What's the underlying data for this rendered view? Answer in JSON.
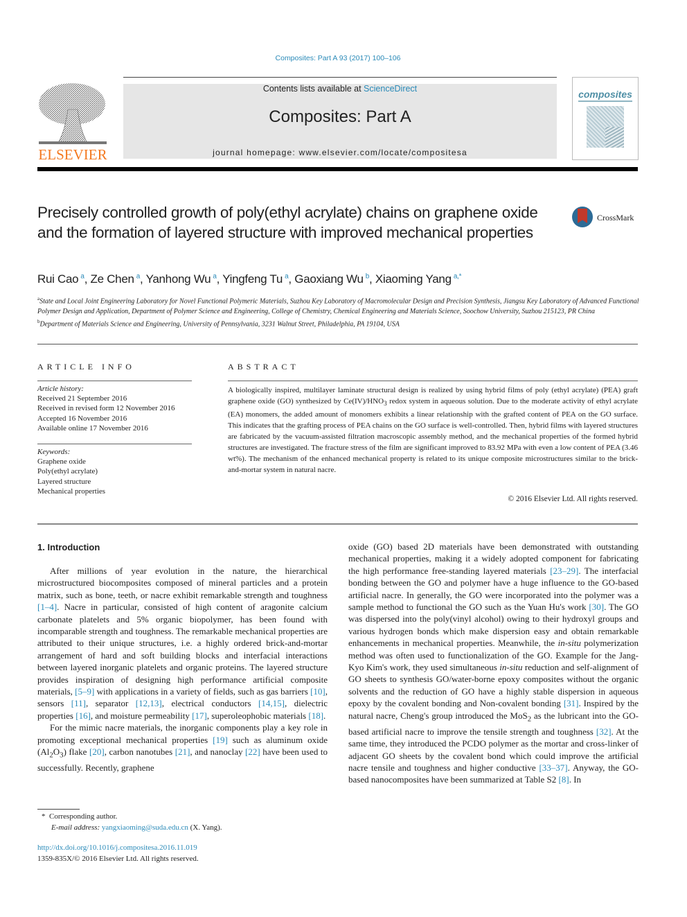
{
  "header": {
    "citation": "Composites: Part A 93 (2017) 100–106",
    "contents_prefix": "Contents lists available at ",
    "contents_link": "ScienceDirect",
    "journal_title": "Composites: Part A",
    "homepage": "journal homepage: www.elsevier.com/locate/compositesa",
    "publisher_logo_text": "ELSEVIER",
    "cover_title": "composites",
    "crossmark_label": "CrossMark",
    "colors": {
      "link": "#2a8ab8",
      "elsevier_orange": "#f47920"
    }
  },
  "article": {
    "title": "Precisely controlled growth of poly(ethyl acrylate) chains on graphene oxide and the formation of layered structure with improved mechanical properties",
    "authors": [
      {
        "name": "Rui Cao",
        "aff": "a"
      },
      {
        "name": "Ze Chen",
        "aff": "a"
      },
      {
        "name": "Yanhong Wu",
        "aff": "a"
      },
      {
        "name": "Yingfeng Tu",
        "aff": "a"
      },
      {
        "name": "Gaoxiang Wu",
        "aff": "b"
      },
      {
        "name": "Xiaoming Yang",
        "aff": "a,*"
      }
    ],
    "affiliations": [
      {
        "label": "a",
        "text": "State and Local Joint Engineering Laboratory for Novel Functional Polymeric Materials, Suzhou Key Laboratory of Macromolecular Design and Precision Synthesis, Jiangsu Key Laboratory of Advanced Functional Polymer Design and Application, Department of Polymer Science and Engineering, College of Chemistry, Chemical Engineering and Materials Science, Soochow University, Suzhou 215123, PR China"
      },
      {
        "label": "b",
        "text": "Department of Materials Science and Engineering, University of Pennsylvania, 3231 Walnut Street, Philadelphia, PA 19104, USA"
      }
    ]
  },
  "article_info": {
    "heading": "ARTICLE INFO",
    "history_label": "Article history:",
    "history": [
      "Received 21 September 2016",
      "Received in revised form 12 November 2016",
      "Accepted 16 November 2016",
      "Available online 17 November 2016"
    ],
    "keywords_label": "Keywords:",
    "keywords": [
      "Graphene oxide",
      "Poly(ethyl acrylate)",
      "Layered structure",
      "Mechanical properties"
    ]
  },
  "abstract": {
    "heading": "ABSTRACT",
    "part1": "A biologically inspired, multilayer laminate structural design is realized by using hybrid films of poly (ethyl acrylate) (PEA) graft graphene oxide (GO) synthesized by Ce(IV)/HNO",
    "sub1": "3",
    "part2": " redox system in aqueous solution. Due to the moderate activity of ethyl acrylate (EA) monomers, the added amount of monomers exhibits a linear relationship with the grafted content of PEA on the GO surface. This indicates that the grafting process of PEA chains on the GO surface is well-controlled. Then, hybrid films with layered structures are fabricated by the vacuum-assisted filtration macroscopic assembly method, and the mechanical properties of the formed hybrid structures are investigated. The fracture stress of the film are significant improved to 83.92 MPa with even a low content of PEA (3.46 wt%). The mechanism of the enhanced mechanical property is related to its unique composite microstructures similar to the brick-and-mortar system in natural nacre.",
    "copyright": "© 2016 Elsevier Ltd. All rights reserved."
  },
  "body": {
    "section_heading": "1. Introduction",
    "left": {
      "p1": [
        {
          "t": "After millions of year evolution in the nature, the hierarchical microstructured biocomposites composed of mineral particles and a protein matrix, such as bone, teeth, or nacre exhibit remarkable strength and toughness "
        },
        {
          "ref": "[1–4]"
        },
        {
          "t": ". Nacre in particular, consisted of high content of aragonite calcium carbonate platelets and 5% organic biopolymer, has been found with incomparable strength and toughness. The remarkable mechanical properties are attributed to their unique structures, i.e. a highly ordered brick-and-mortar arrangement of hard and soft building blocks and interfacial interactions between layered inorganic platelets and organic proteins. The layered structure provides inspiration of designing high performance artificial composite materials, "
        },
        {
          "ref": "[5–9]"
        },
        {
          "t": " with applications in a variety of fields, such as gas barriers "
        },
        {
          "ref": "[10]"
        },
        {
          "t": ", sensors "
        },
        {
          "ref": "[11]"
        },
        {
          "t": ", separator "
        },
        {
          "ref": "[12,13]"
        },
        {
          "t": ", electrical conductors "
        },
        {
          "ref": "[14,15]"
        },
        {
          "t": ", dielectric properties "
        },
        {
          "ref": "[16]"
        },
        {
          "t": ", and moisture permeability "
        },
        {
          "ref": "[17]"
        },
        {
          "t": ", superoleophobic materials "
        },
        {
          "ref": "[18]"
        },
        {
          "t": "."
        }
      ],
      "p2": [
        {
          "t": "For the mimic nacre materials, the inorganic components play a key role in promoting exceptional mechanical properties "
        },
        {
          "ref": "[19]"
        },
        {
          "t": " such as aluminum oxide (Al"
        },
        {
          "sub": "2"
        },
        {
          "t": "O"
        },
        {
          "sub": "3"
        },
        {
          "t": ") flake "
        },
        {
          "ref": "[20]"
        },
        {
          "t": ", carbon nanotubes "
        },
        {
          "ref": "[21]"
        },
        {
          "t": ", and nanoclay "
        },
        {
          "ref": "[22]"
        },
        {
          "t": " have been used to successfully. Recently, graphene"
        }
      ]
    },
    "right": {
      "p1": [
        {
          "t": "oxide (GO) based 2D materials have been demonstrated with outstanding mechanical properties, making it a widely adopted component for fabricating the high performance free-standing layered materials "
        },
        {
          "ref": "[23–29]"
        },
        {
          "t": ". The interfacial bonding between the GO and polymer have a huge influence to the GO-based artificial nacre. In generally, the GO were incorporated into the polymer was a sample method to functional the GO such as the Yuan Hu's work "
        },
        {
          "ref": "[30]"
        },
        {
          "t": ". The GO was dispersed into the poly(vinyl alcohol) owing to their hydroxyl groups and various hydrogen bonds which make dispersion easy and obtain remarkable enhancements in mechanical properties. Meanwhile, the "
        },
        {
          "i": "in-situ"
        },
        {
          "t": " polymerization method was often used to functionalization of the GO. Example for the Jang-Kyo Kim's work, they used simultaneous "
        },
        {
          "i": "in-situ"
        },
        {
          "t": " reduction and self-alignment of GO sheets to synthesis GO/water-borne epoxy composites without the organic solvents and the reduction of GO have a highly stable dispersion in aqueous epoxy by the covalent bonding and Non-covalent bonding "
        },
        {
          "ref": "[31]"
        },
        {
          "t": ". Inspired by the natural nacre, Cheng's group introduced the MoS"
        },
        {
          "sub": "2"
        },
        {
          "t": " as the lubricant into the GO-based artificial nacre to improve the tensile strength and toughness "
        },
        {
          "ref": "[32]"
        },
        {
          "t": ". At the same time, they introduced the PCDO polymer as the mortar and cross-linker of adjacent GO sheets by the covalent bond which could improve the artificial nacre tensile and toughness and higher conductive "
        },
        {
          "ref": "[33–37]"
        },
        {
          "t": ". Anyway, the GO-based nanocomposites have been summarized at Table S2 "
        },
        {
          "ref": "[8]"
        },
        {
          "t": ". In"
        }
      ]
    }
  },
  "footnotes": {
    "corresponding_mark": "*",
    "corresponding": "Corresponding author.",
    "email_label": "E-mail address:",
    "email": "yangxiaoming@suda.edu.cn",
    "email_suffix": " (X. Yang).",
    "doi": "http://dx.doi.org/10.1016/j.compositesa.2016.11.019",
    "issn": "1359-835X/© 2016 Elsevier Ltd. All rights reserved."
  }
}
